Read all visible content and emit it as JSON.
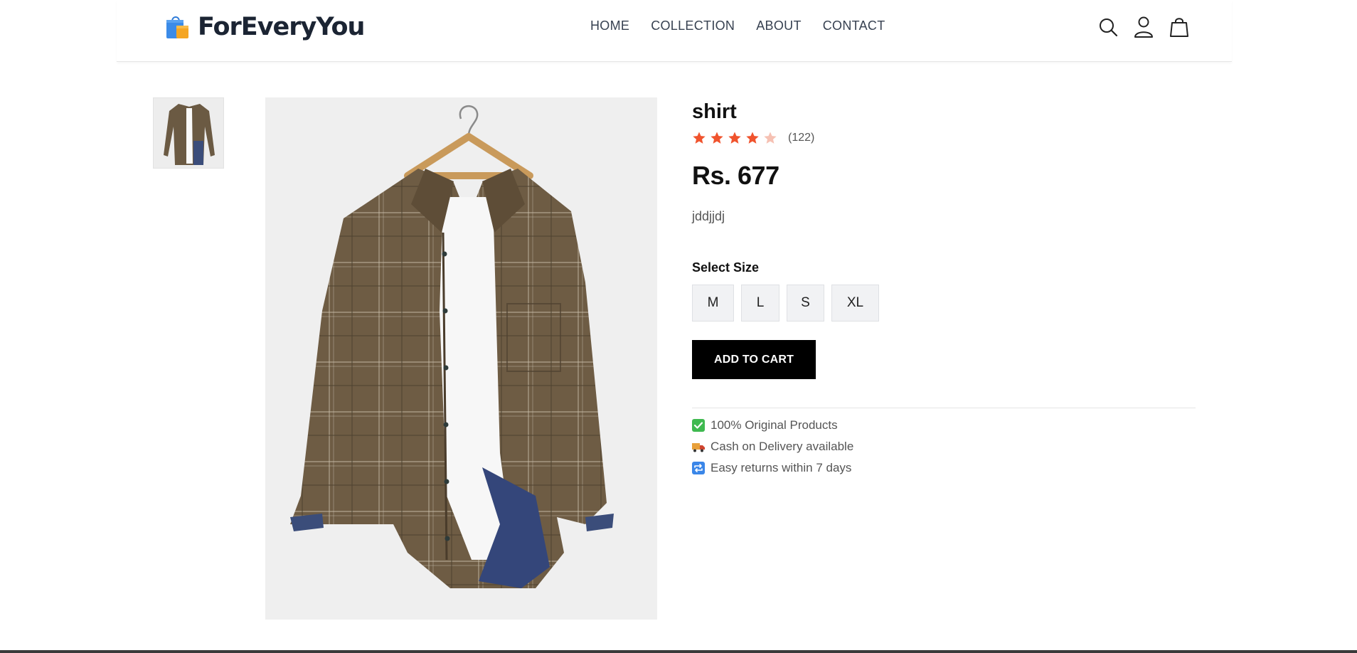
{
  "header": {
    "brand": "ForEveryYou",
    "nav": [
      "HOME",
      "COLLECTION",
      "ABOUT",
      "CONTACT"
    ],
    "icons": [
      "search-icon",
      "user-icon",
      "shopping-bag-icon"
    ]
  },
  "product": {
    "title": "shirt",
    "rating_stars": 4,
    "rating_max": 5,
    "review_count": "(122)",
    "price": "Rs. 677",
    "description": "jddjjdj",
    "size_label": "Select Size",
    "sizes": [
      "M",
      "L",
      "S",
      "XL"
    ],
    "add_to_cart": "ADD TO CART",
    "perks": [
      {
        "icon": "check-icon",
        "text": "100% Original Products"
      },
      {
        "icon": "truck-icon",
        "text": "Cash on Delivery available"
      },
      {
        "icon": "repeat-icon",
        "text": "Easy returns within 7 days"
      }
    ]
  },
  "colors": {
    "star_filled": "#f0532d",
    "star_empty": "#f6c1b3",
    "button_bg": "#000000",
    "brand_text": "#1b2433"
  }
}
